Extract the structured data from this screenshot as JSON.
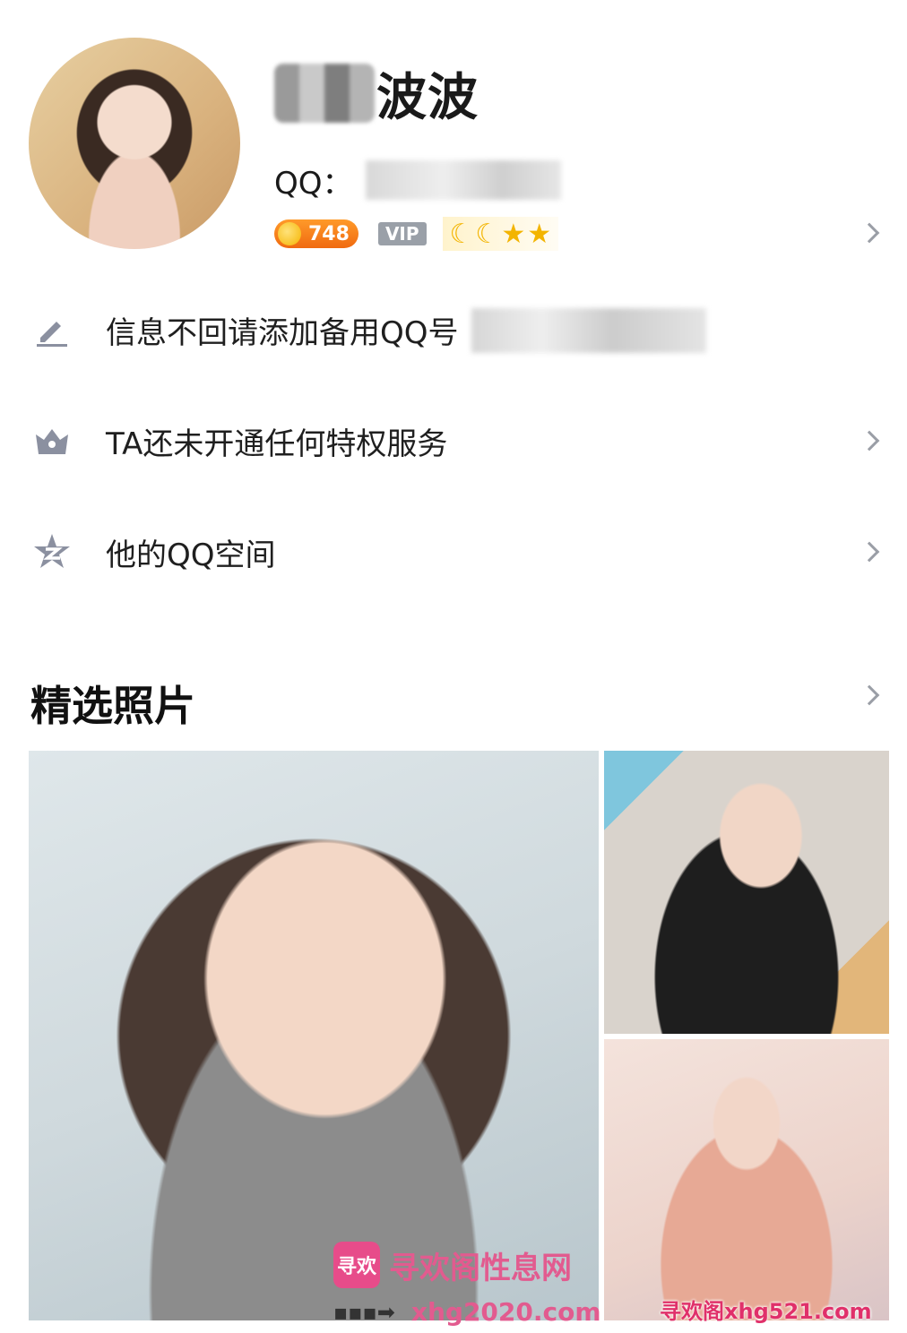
{
  "profile": {
    "name_visible": "波波",
    "qq_label": "QQ：",
    "coin_count": "748",
    "vip_label": "VIP"
  },
  "rows": [
    {
      "label": "信息不回请添加备用QQ号",
      "icon": "pencil-icon"
    },
    {
      "label": "TA还未开通任何特权服务",
      "icon": "crown-icon"
    },
    {
      "label": "他的QQ空间",
      "icon": "qzone-star-icon"
    }
  ],
  "photos_section": {
    "title": "精选照片"
  },
  "watermarks": {
    "site_name": "寻欢阁性息网",
    "site_url": "xhg2020.com",
    "logo_text": "寻欢",
    "corner_text": "寻欢阁xhg521.com"
  },
  "colors": {
    "coin_badge": "#f06a10",
    "vip_badge": "#9aa0a8",
    "chevron": "#9a9ea6",
    "watermark_pink": "#e25b8f"
  }
}
